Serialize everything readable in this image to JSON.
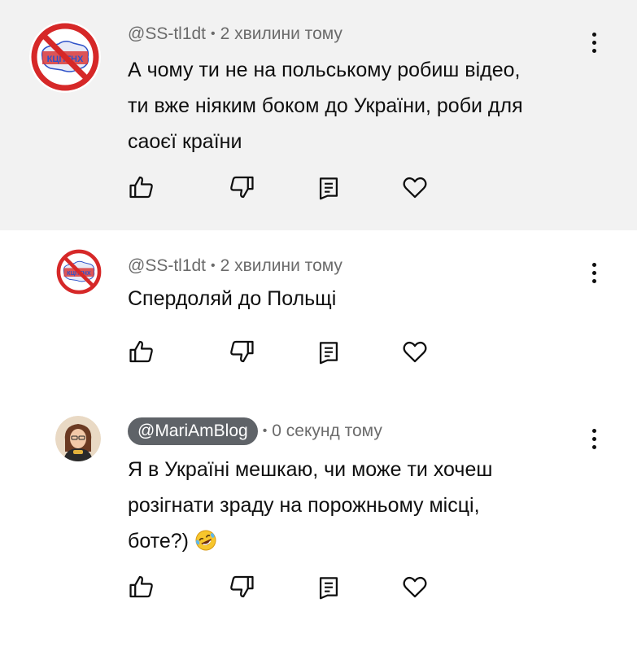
{
  "comments": [
    {
      "author": "@SS-tl1dt",
      "time": "2 хвилини тому",
      "avatar_text": "КЦПТНХ",
      "lines": [
        "А чому ти не на польському робиш відео,",
        "ти вже ніяким боком до України, роби для",
        "саоєї країни"
      ]
    },
    {
      "author": "@SS-tl1dt",
      "time": "2 хвилини тому",
      "avatar_text": "КЦПТНХ",
      "lines": [
        "Спердоляй до Польщі"
      ]
    },
    {
      "author": "@MariAmBlog",
      "time": "0 секунд тому",
      "lines": [
        "Я в Україні мешкаю,  чи може ти хочеш",
        "розігнати зраду на порожньому місці,",
        "боте?)"
      ],
      "emoji": "rolling-on-floor-laughing"
    }
  ],
  "separator": "•",
  "icons": {
    "like": "thumbs-up-icon",
    "dislike": "thumbs-down-icon",
    "reply": "reply-icon",
    "heart": "heart-icon",
    "more": "more-vert-icon"
  },
  "colors": {
    "highlight_bg": "#f2f2f2",
    "meta_text": "#6b6b6b",
    "badge_bg": "#5f6368",
    "avatar_red": "#d62828",
    "avatar_blue": "#2e52c9"
  }
}
